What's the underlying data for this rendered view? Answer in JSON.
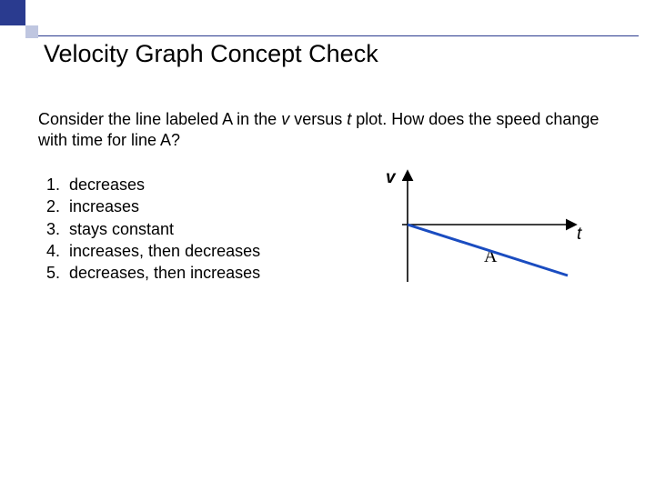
{
  "title": "Velocity Graph Concept Check",
  "question_pre": "Consider the line labeled A in the ",
  "question_v": "v",
  "question_mid": " versus ",
  "question_t": "t",
  "question_post": " plot. How does the speed change with time for line A?",
  "options": [
    {
      "num": "1.",
      "text": "decreases"
    },
    {
      "num": "2.",
      "text": "increases"
    },
    {
      "num": "3.",
      "text": "stays constant"
    },
    {
      "num": "4.",
      "text": "increases, then decreases"
    },
    {
      "num": "5.",
      "text": "decreases, then increases"
    }
  ],
  "axis_y": "v",
  "axis_x": "t",
  "line_label": "A",
  "chart_data": {
    "type": "line",
    "title": "",
    "xlabel": "t",
    "ylabel": "v",
    "series": [
      {
        "name": "A",
        "x": [
          0,
          1
        ],
        "y": [
          0,
          -0.55
        ]
      }
    ],
    "xlim": [
      0,
      1
    ],
    "ylim": [
      -1,
      1
    ],
    "note": "Line A starts at origin with v=0 and goes to negative v as t increases; speed (|v|) increases with time."
  }
}
